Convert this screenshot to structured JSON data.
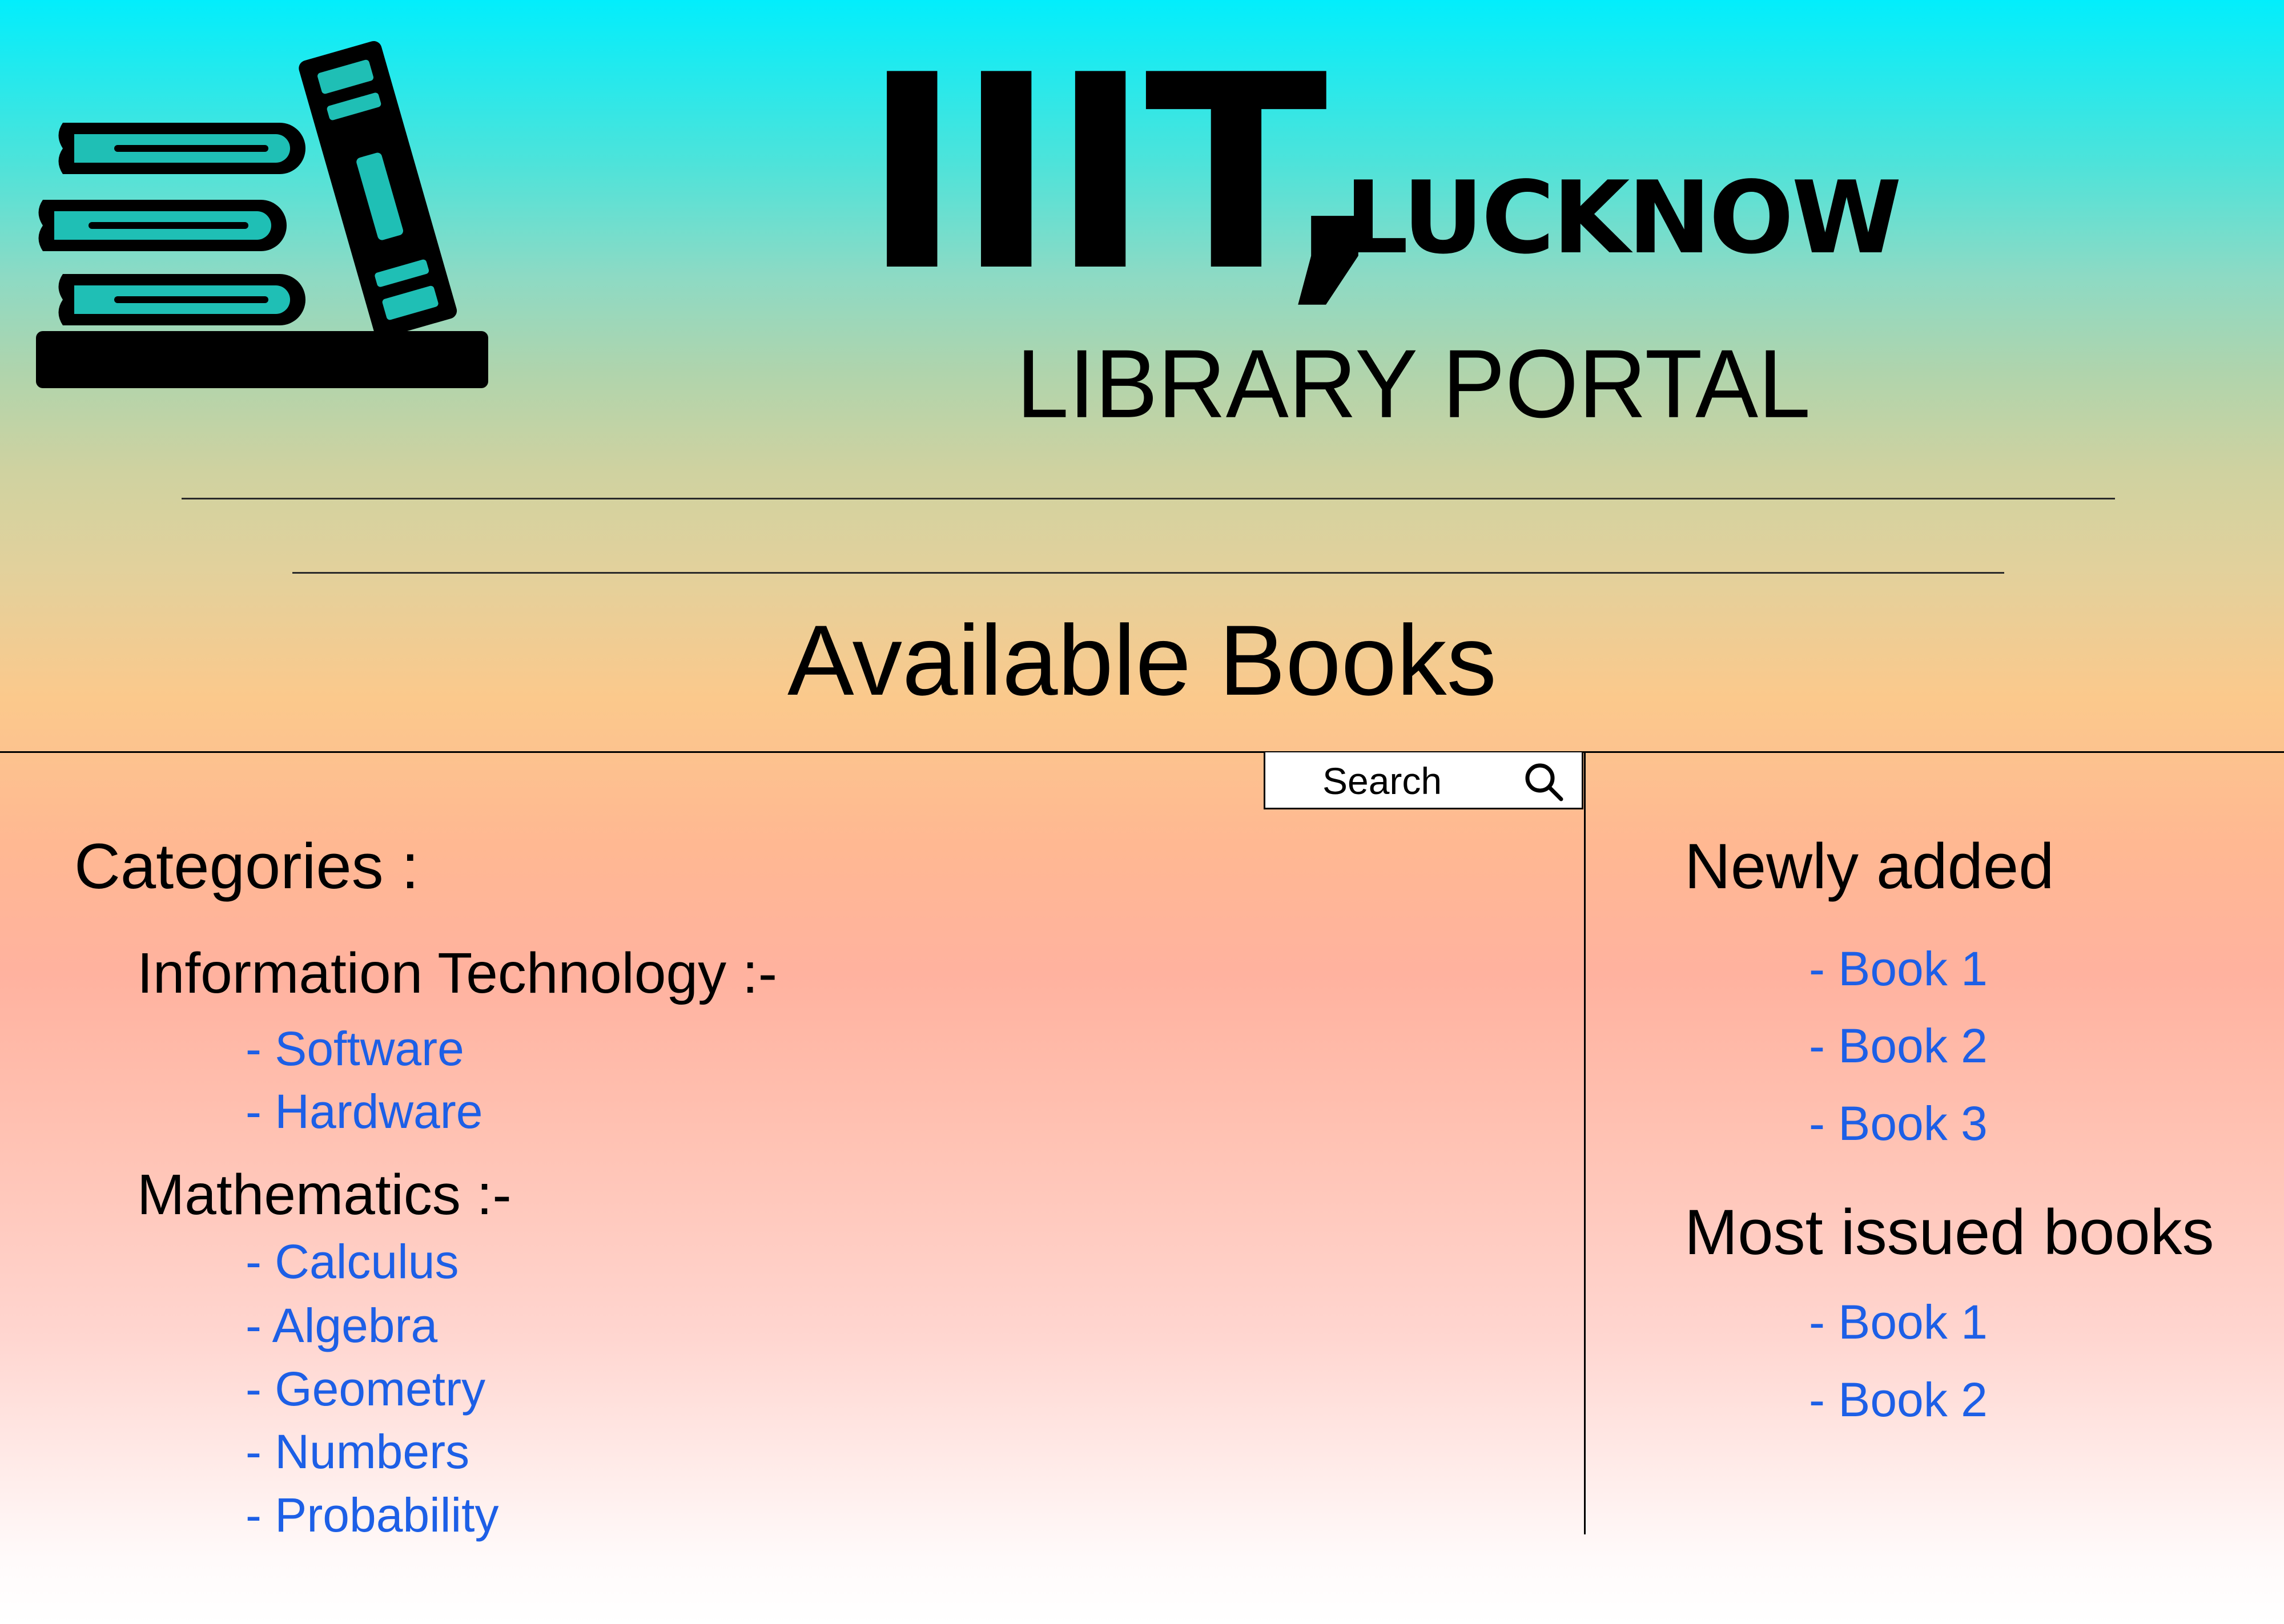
{
  "header": {
    "title_main": "IIIT,",
    "title_sub": "LUCKNOW",
    "portal_title": "LIBRARY PORTAL",
    "logo_icon": "books-icon"
  },
  "main": {
    "section_title": "Available Books"
  },
  "search": {
    "placeholder": "Search",
    "icon": "search-icon"
  },
  "categories": {
    "heading": "Categories :",
    "groups": [
      {
        "title": "Information Technology :-",
        "items": [
          "- Software",
          "- Hardware"
        ]
      },
      {
        "title": "Mathematics :-",
        "items": [
          "- Calculus",
          "- Algebra",
          "- Geometry",
          "- Numbers",
          "- Probability"
        ]
      }
    ]
  },
  "sidebar": {
    "newly_added": {
      "heading": "Newly added",
      "items": [
        "- Book 1",
        "- Book 2",
        "- Book 3"
      ]
    },
    "most_issued": {
      "heading": "Most issued books",
      "items": [
        "- Book 1",
        "- Book 2"
      ]
    }
  },
  "colors": {
    "link": "#1d5fe6",
    "gradient_top": "#02eefc",
    "gradient_mid": "#fbc98c",
    "gradient_bottom": "#ffffff"
  }
}
